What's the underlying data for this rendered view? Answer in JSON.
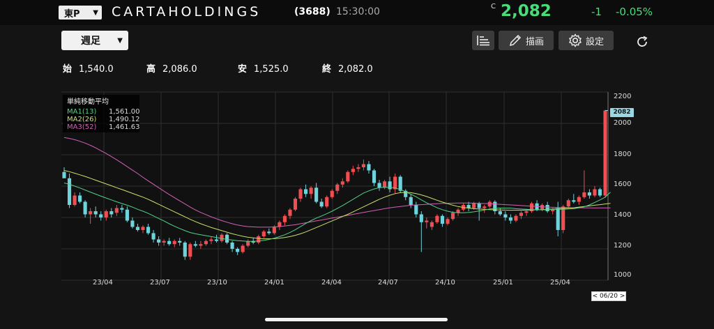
{
  "header": {
    "market": "東P",
    "company_name": "CARTAHOLDINGS",
    "code": "(3688)",
    "time": "15:30:00",
    "price_mark": "C",
    "price": "2,082",
    "change": "-1",
    "change_pct": "-0.05%",
    "price_color": "#49dd7a"
  },
  "toolbar": {
    "period": "週足",
    "draw_label": "描画",
    "settings_label": "設定",
    "icons": [
      "bar-list-icon",
      "pencil-icon",
      "gear-icon",
      "refresh-icon"
    ]
  },
  "ohlc": [
    {
      "label": "始",
      "value": "1,540.0"
    },
    {
      "label": "高",
      "value": "2,086.0"
    },
    {
      "label": "安",
      "value": "1,525.0"
    },
    {
      "label": "終",
      "value": "2,082.0"
    }
  ],
  "chart_data": {
    "type": "candlestick",
    "y_ticks": [
      "2200",
      "2000",
      "1800",
      "1600",
      "1400",
      "1200",
      "1000"
    ],
    "ylim": [
      1000,
      2200
    ],
    "x_ticks": [
      "23/04",
      "23/07",
      "23/10",
      "24/01",
      "24/04",
      "24/07",
      "24/10",
      "25/01",
      "25/04"
    ],
    "last_price_label": "2082",
    "date_tag": "< 06/20 >",
    "legend_title": "単純移動平均",
    "moving_averages": [
      {
        "name": "MA1(13)",
        "value": "1,561.00",
        "color": "#52d18a"
      },
      {
        "name": "MA2(26)",
        "value": "1,490.12",
        "color": "#c9e26a"
      },
      {
        "name": "MA3(52)",
        "value": "1,461.63",
        "color": "#d461b8"
      }
    ],
    "up_color": "#ef4f52",
    "down_color": "#6fd3dc",
    "candles": [
      [
        1690,
        1720,
        1660,
        1650
      ],
      [
        1650,
        1680,
        1460,
        1480
      ],
      [
        1480,
        1560,
        1470,
        1540
      ],
      [
        1540,
        1560,
        1490,
        1500
      ],
      [
        1500,
        1510,
        1400,
        1420
      ],
      [
        1420,
        1460,
        1360,
        1440
      ],
      [
        1440,
        1470,
        1400,
        1420
      ],
      [
        1420,
        1440,
        1380,
        1400
      ],
      [
        1400,
        1450,
        1380,
        1440
      ],
      [
        1440,
        1460,
        1400,
        1420
      ],
      [
        1430,
        1480,
        1410,
        1460
      ],
      [
        1460,
        1480,
        1430,
        1450
      ],
      [
        1450,
        1470,
        1370,
        1380
      ],
      [
        1380,
        1400,
        1330,
        1340
      ],
      [
        1340,
        1360,
        1310,
        1320
      ],
      [
        1320,
        1350,
        1300,
        1340
      ],
      [
        1340,
        1360,
        1290,
        1300
      ],
      [
        1300,
        1320,
        1240,
        1260
      ],
      [
        1260,
        1280,
        1220,
        1240
      ],
      [
        1240,
        1260,
        1220,
        1250
      ],
      [
        1250,
        1270,
        1220,
        1230
      ],
      [
        1230,
        1260,
        1210,
        1250
      ],
      [
        1250,
        1270,
        1220,
        1240
      ],
      [
        1240,
        1250,
        1130,
        1150
      ],
      [
        1150,
        1240,
        1130,
        1230
      ],
      [
        1230,
        1250,
        1210,
        1220
      ],
      [
        1220,
        1250,
        1200,
        1230
      ],
      [
        1230,
        1260,
        1220,
        1250
      ],
      [
        1250,
        1280,
        1230,
        1260
      ],
      [
        1260,
        1290,
        1240,
        1250
      ],
      [
        1250,
        1300,
        1240,
        1290
      ],
      [
        1290,
        1300,
        1230,
        1240
      ],
      [
        1240,
        1250,
        1180,
        1200
      ],
      [
        1200,
        1210,
        1160,
        1180
      ],
      [
        1180,
        1230,
        1170,
        1220
      ],
      [
        1220,
        1260,
        1210,
        1250
      ],
      [
        1250,
        1270,
        1230,
        1240
      ],
      [
        1240,
        1290,
        1230,
        1280
      ],
      [
        1280,
        1320,
        1270,
        1310
      ],
      [
        1310,
        1330,
        1290,
        1300
      ],
      [
        1300,
        1350,
        1290,
        1340
      ],
      [
        1340,
        1380,
        1320,
        1370
      ],
      [
        1370,
        1420,
        1350,
        1410
      ],
      [
        1410,
        1460,
        1390,
        1450
      ],
      [
        1450,
        1530,
        1440,
        1520
      ],
      [
        1520,
        1590,
        1500,
        1580
      ],
      [
        1580,
        1610,
        1530,
        1550
      ],
      [
        1550,
        1600,
        1520,
        1590
      ],
      [
        1590,
        1620,
        1490,
        1500
      ],
      [
        1500,
        1520,
        1460,
        1470
      ],
      [
        1470,
        1540,
        1460,
        1530
      ],
      [
        1530,
        1580,
        1520,
        1570
      ],
      [
        1570,
        1620,
        1550,
        1610
      ],
      [
        1610,
        1650,
        1590,
        1630
      ],
      [
        1630,
        1700,
        1620,
        1690
      ],
      [
        1690,
        1730,
        1670,
        1710
      ],
      [
        1710,
        1740,
        1690,
        1720
      ],
      [
        1720,
        1770,
        1700,
        1740
      ],
      [
        1740,
        1760,
        1680,
        1700
      ],
      [
        1700,
        1710,
        1600,
        1620
      ],
      [
        1620,
        1640,
        1570,
        1590
      ],
      [
        1590,
        1640,
        1580,
        1630
      ],
      [
        1630,
        1660,
        1560,
        1580
      ],
      [
        1580,
        1680,
        1550,
        1660
      ],
      [
        1660,
        1670,
        1560,
        1570
      ],
      [
        1570,
        1580,
        1510,
        1530
      ],
      [
        1530,
        1550,
        1460,
        1480
      ],
      [
        1480,
        1500,
        1400,
        1420
      ],
      [
        1420,
        1440,
        1180,
        1370
      ],
      [
        1370,
        1400,
        1330,
        1380
      ],
      [
        1340,
        1380,
        1320,
        1370
      ],
      [
        1370,
        1420,
        1360,
        1410
      ],
      [
        1410,
        1420,
        1340,
        1360
      ],
      [
        1360,
        1400,
        1350,
        1390
      ],
      [
        1390,
        1440,
        1380,
        1430
      ],
      [
        1430,
        1460,
        1410,
        1450
      ],
      [
        1450,
        1490,
        1440,
        1480
      ],
      [
        1480,
        1500,
        1440,
        1460
      ],
      [
        1460,
        1500,
        1450,
        1490
      ],
      [
        1490,
        1500,
        1380,
        1460
      ],
      [
        1460,
        1480,
        1430,
        1470
      ],
      [
        1470,
        1510,
        1460,
        1500
      ],
      [
        1500,
        1510,
        1420,
        1440
      ],
      [
        1440,
        1460,
        1410,
        1420
      ],
      [
        1420,
        1440,
        1380,
        1400
      ],
      [
        1400,
        1420,
        1360,
        1380
      ],
      [
        1380,
        1420,
        1370,
        1410
      ],
      [
        1410,
        1440,
        1390,
        1430
      ],
      [
        1430,
        1450,
        1410,
        1440
      ],
      [
        1440,
        1500,
        1430,
        1490
      ],
      [
        1490,
        1510,
        1440,
        1450
      ],
      [
        1450,
        1490,
        1440,
        1480
      ],
      [
        1480,
        1500,
        1430,
        1440
      ],
      [
        1440,
        1460,
        1420,
        1450
      ],
      [
        1460,
        1500,
        1280,
        1320
      ],
      [
        1320,
        1480,
        1300,
        1470
      ],
      [
        1470,
        1520,
        1460,
        1510
      ],
      [
        1510,
        1550,
        1490,
        1500
      ],
      [
        1500,
        1540,
        1480,
        1530
      ],
      [
        1530,
        1700,
        1520,
        1560
      ],
      [
        1560,
        1580,
        1520,
        1540
      ],
      [
        1540,
        1600,
        1530,
        1580
      ],
      [
        1580,
        1590,
        1530,
        1540
      ],
      [
        1540,
        2086,
        1525,
        2082
      ]
    ],
    "ma1": [
      1620,
      1612,
      1600,
      1588,
      1575,
      1562,
      1549,
      1536,
      1524,
      1512,
      1500,
      1489,
      1478,
      1466,
      1452,
      1440,
      1426,
      1410,
      1394,
      1378,
      1360,
      1344,
      1330,
      1316,
      1304,
      1296,
      1290,
      1284,
      1278,
      1272,
      1266,
      1260,
      1256,
      1252,
      1250,
      1248,
      1248,
      1250,
      1254,
      1260,
      1268,
      1278,
      1290,
      1305,
      1322,
      1342,
      1362,
      1380,
      1396,
      1410,
      1424,
      1440,
      1458,
      1476,
      1496,
      1516,
      1536,
      1556,
      1570,
      1582,
      1590,
      1592,
      1592,
      1588,
      1578,
      1564,
      1548,
      1532,
      1512,
      1494,
      1478,
      1462,
      1450,
      1440,
      1433,
      1430,
      1430,
      1432,
      1436,
      1442,
      1448,
      1454,
      1458,
      1460,
      1460,
      1460,
      1456,
      1454,
      1452,
      1450,
      1449,
      1449,
      1450,
      1452,
      1452,
      1452,
      1454,
      1456,
      1462,
      1468,
      1480,
      1496,
      1512,
      1530,
      1561
    ],
    "ma2": [
      1700,
      1692,
      1682,
      1672,
      1662,
      1650,
      1638,
      1626,
      1614,
      1602,
      1590,
      1578,
      1566,
      1554,
      1542,
      1530,
      1516,
      1500,
      1484,
      1468,
      1452,
      1436,
      1420,
      1404,
      1388,
      1374,
      1360,
      1348,
      1336,
      1326,
      1316,
      1306,
      1296,
      1288,
      1280,
      1274,
      1270,
      1266,
      1264,
      1264,
      1265,
      1268,
      1272,
      1278,
      1286,
      1296,
      1308,
      1322,
      1336,
      1350,
      1364,
      1378,
      1392,
      1406,
      1420,
      1436,
      1452,
      1468,
      1484,
      1500,
      1516,
      1530,
      1542,
      1552,
      1558,
      1560,
      1558,
      1552,
      1544,
      1534,
      1522,
      1510,
      1498,
      1488,
      1478,
      1470,
      1464,
      1460,
      1456,
      1454,
      1452,
      1450,
      1449,
      1448,
      1447,
      1446,
      1446,
      1446,
      1447,
      1448,
      1449,
      1450,
      1452,
      1454,
      1456,
      1458,
      1460,
      1462,
      1466,
      1470,
      1474,
      1478,
      1482,
      1486,
      1490
    ],
    "ma3": [
      1910,
      1904,
      1896,
      1886,
      1874,
      1860,
      1844,
      1826,
      1808,
      1788,
      1768,
      1746,
      1724,
      1702,
      1680,
      1656,
      1634,
      1612,
      1590,
      1568,
      1546,
      1526,
      1506,
      1486,
      1466,
      1448,
      1432,
      1418,
      1404,
      1392,
      1380,
      1370,
      1360,
      1352,
      1346,
      1342,
      1340,
      1338,
      1338,
      1338,
      1340,
      1342,
      1346,
      1350,
      1354,
      1360,
      1366,
      1372,
      1378,
      1384,
      1390,
      1396,
      1402,
      1408,
      1414,
      1420,
      1426,
      1432,
      1438,
      1444,
      1450,
      1456,
      1462,
      1466,
      1470,
      1474,
      1478,
      1480,
      1482,
      1484,
      1486,
      1488,
      1490,
      1490,
      1491,
      1492,
      1492,
      1492,
      1491,
      1490,
      1489,
      1488,
      1486,
      1484,
      1482,
      1480,
      1478,
      1476,
      1474,
      1472,
      1470,
      1468,
      1466,
      1465,
      1464,
      1463,
      1462,
      1462,
      1462,
      1462,
      1461,
      1461,
      1461,
      1461,
      1461
    ]
  }
}
